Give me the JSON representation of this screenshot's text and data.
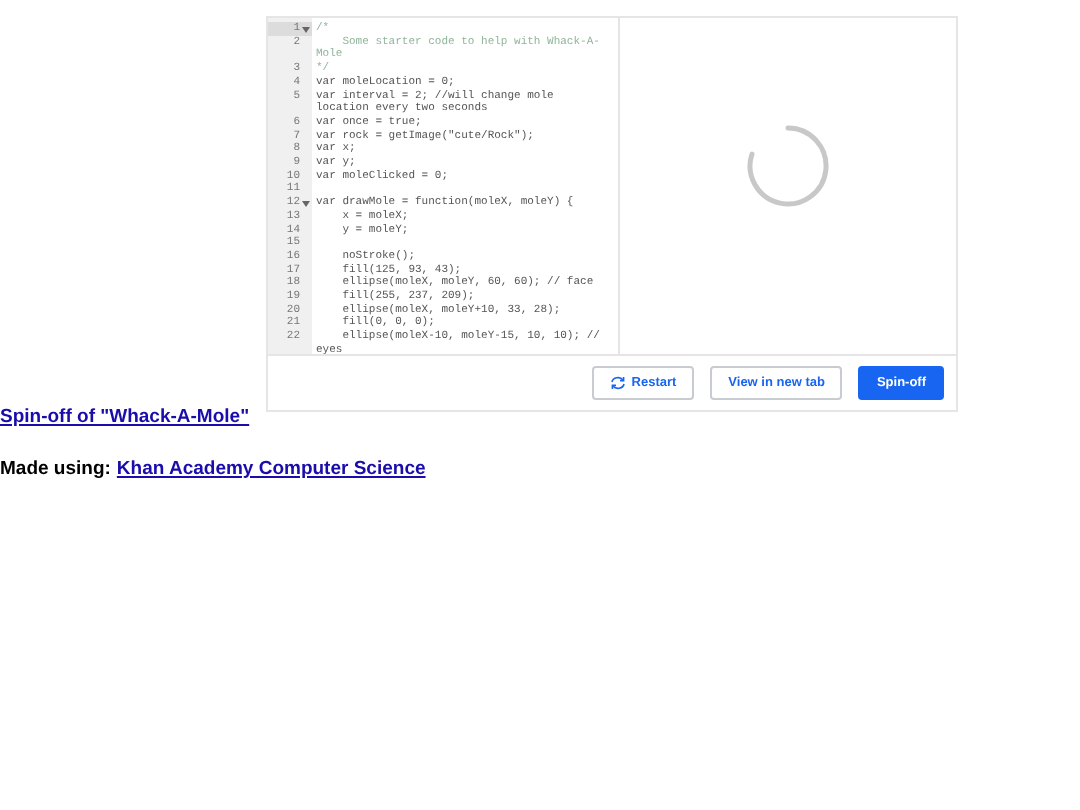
{
  "editor": {
    "lines": [
      {
        "number": "1",
        "text": "/*",
        "kind": "comment",
        "fold": true,
        "selected": true
      },
      {
        "number": "2",
        "text": "    Some starter code to help with Whack-A-Mole",
        "kind": "comment",
        "fold": false,
        "selected": false
      },
      {
        "number": "3",
        "text": "*/",
        "kind": "comment",
        "fold": false,
        "selected": false
      },
      {
        "number": "4",
        "text": "var moleLocation = 0;",
        "kind": "code",
        "fold": false,
        "selected": false
      },
      {
        "number": "5",
        "text": "var interval = 2; //will change mole location every two seconds",
        "kind": "code",
        "fold": false,
        "selected": false
      },
      {
        "number": "6",
        "text": "var once = true;",
        "kind": "code",
        "fold": false,
        "selected": false
      },
      {
        "number": "7",
        "text": "var rock = getImage(\"cute/Rock\");",
        "kind": "code",
        "fold": false,
        "selected": false
      },
      {
        "number": "8",
        "text": "var x;",
        "kind": "code",
        "fold": false,
        "selected": false
      },
      {
        "number": "9",
        "text": "var y;",
        "kind": "code",
        "fold": false,
        "selected": false
      },
      {
        "number": "10",
        "text": "var moleClicked = 0;",
        "kind": "code",
        "fold": false,
        "selected": false
      },
      {
        "number": "11",
        "fold": false,
        "selected": false
      },
      {
        "number": "12",
        "text": "var drawMole = function(moleX, moleY) {",
        "kind": "code",
        "fold": true,
        "selected": false
      },
      {
        "number": "13",
        "text": "    x = moleX;",
        "kind": "code",
        "fold": false,
        "selected": false
      },
      {
        "number": "14",
        "text": "    y = moleY;",
        "kind": "code",
        "fold": false,
        "selected": false
      },
      {
        "number": "15",
        "fold": false,
        "selected": false
      },
      {
        "number": "16",
        "text": "    noStroke();",
        "kind": "code",
        "fold": false,
        "selected": false
      },
      {
        "number": "17",
        "text": "    fill(125, 93, 43);",
        "kind": "code",
        "fold": false,
        "selected": false
      },
      {
        "number": "18",
        "text": "    ellipse(moleX, moleY, 60, 60); // face",
        "kind": "code",
        "fold": false,
        "selected": false
      },
      {
        "number": "19",
        "text": "    fill(255, 237, 209);",
        "kind": "code",
        "fold": false,
        "selected": false
      },
      {
        "number": "20",
        "text": "    ellipse(moleX, moleY+10, 33, 28);",
        "kind": "code",
        "fold": false,
        "selected": false
      },
      {
        "number": "21",
        "text": "    fill(0, 0, 0);",
        "kind": "code",
        "fold": false,
        "selected": false
      },
      {
        "number": "22",
        "text": "    ellipse(moleX-10, moleY-15, 10, 10); // eyes",
        "kind": "code",
        "fold": false,
        "selected": false
      }
    ]
  },
  "buttons": [
    {
      "label": "Restart",
      "kind": "restart"
    },
    {
      "label": "View in new tab",
      "kind": "outline"
    },
    {
      "label": "Spin-off",
      "kind": "primary"
    }
  ],
  "title_link": "Spin-off of \"Whack-A-Mole\"",
  "made_using": {
    "label": "Made using:",
    "link": "Khan Academy Computer Science"
  }
}
